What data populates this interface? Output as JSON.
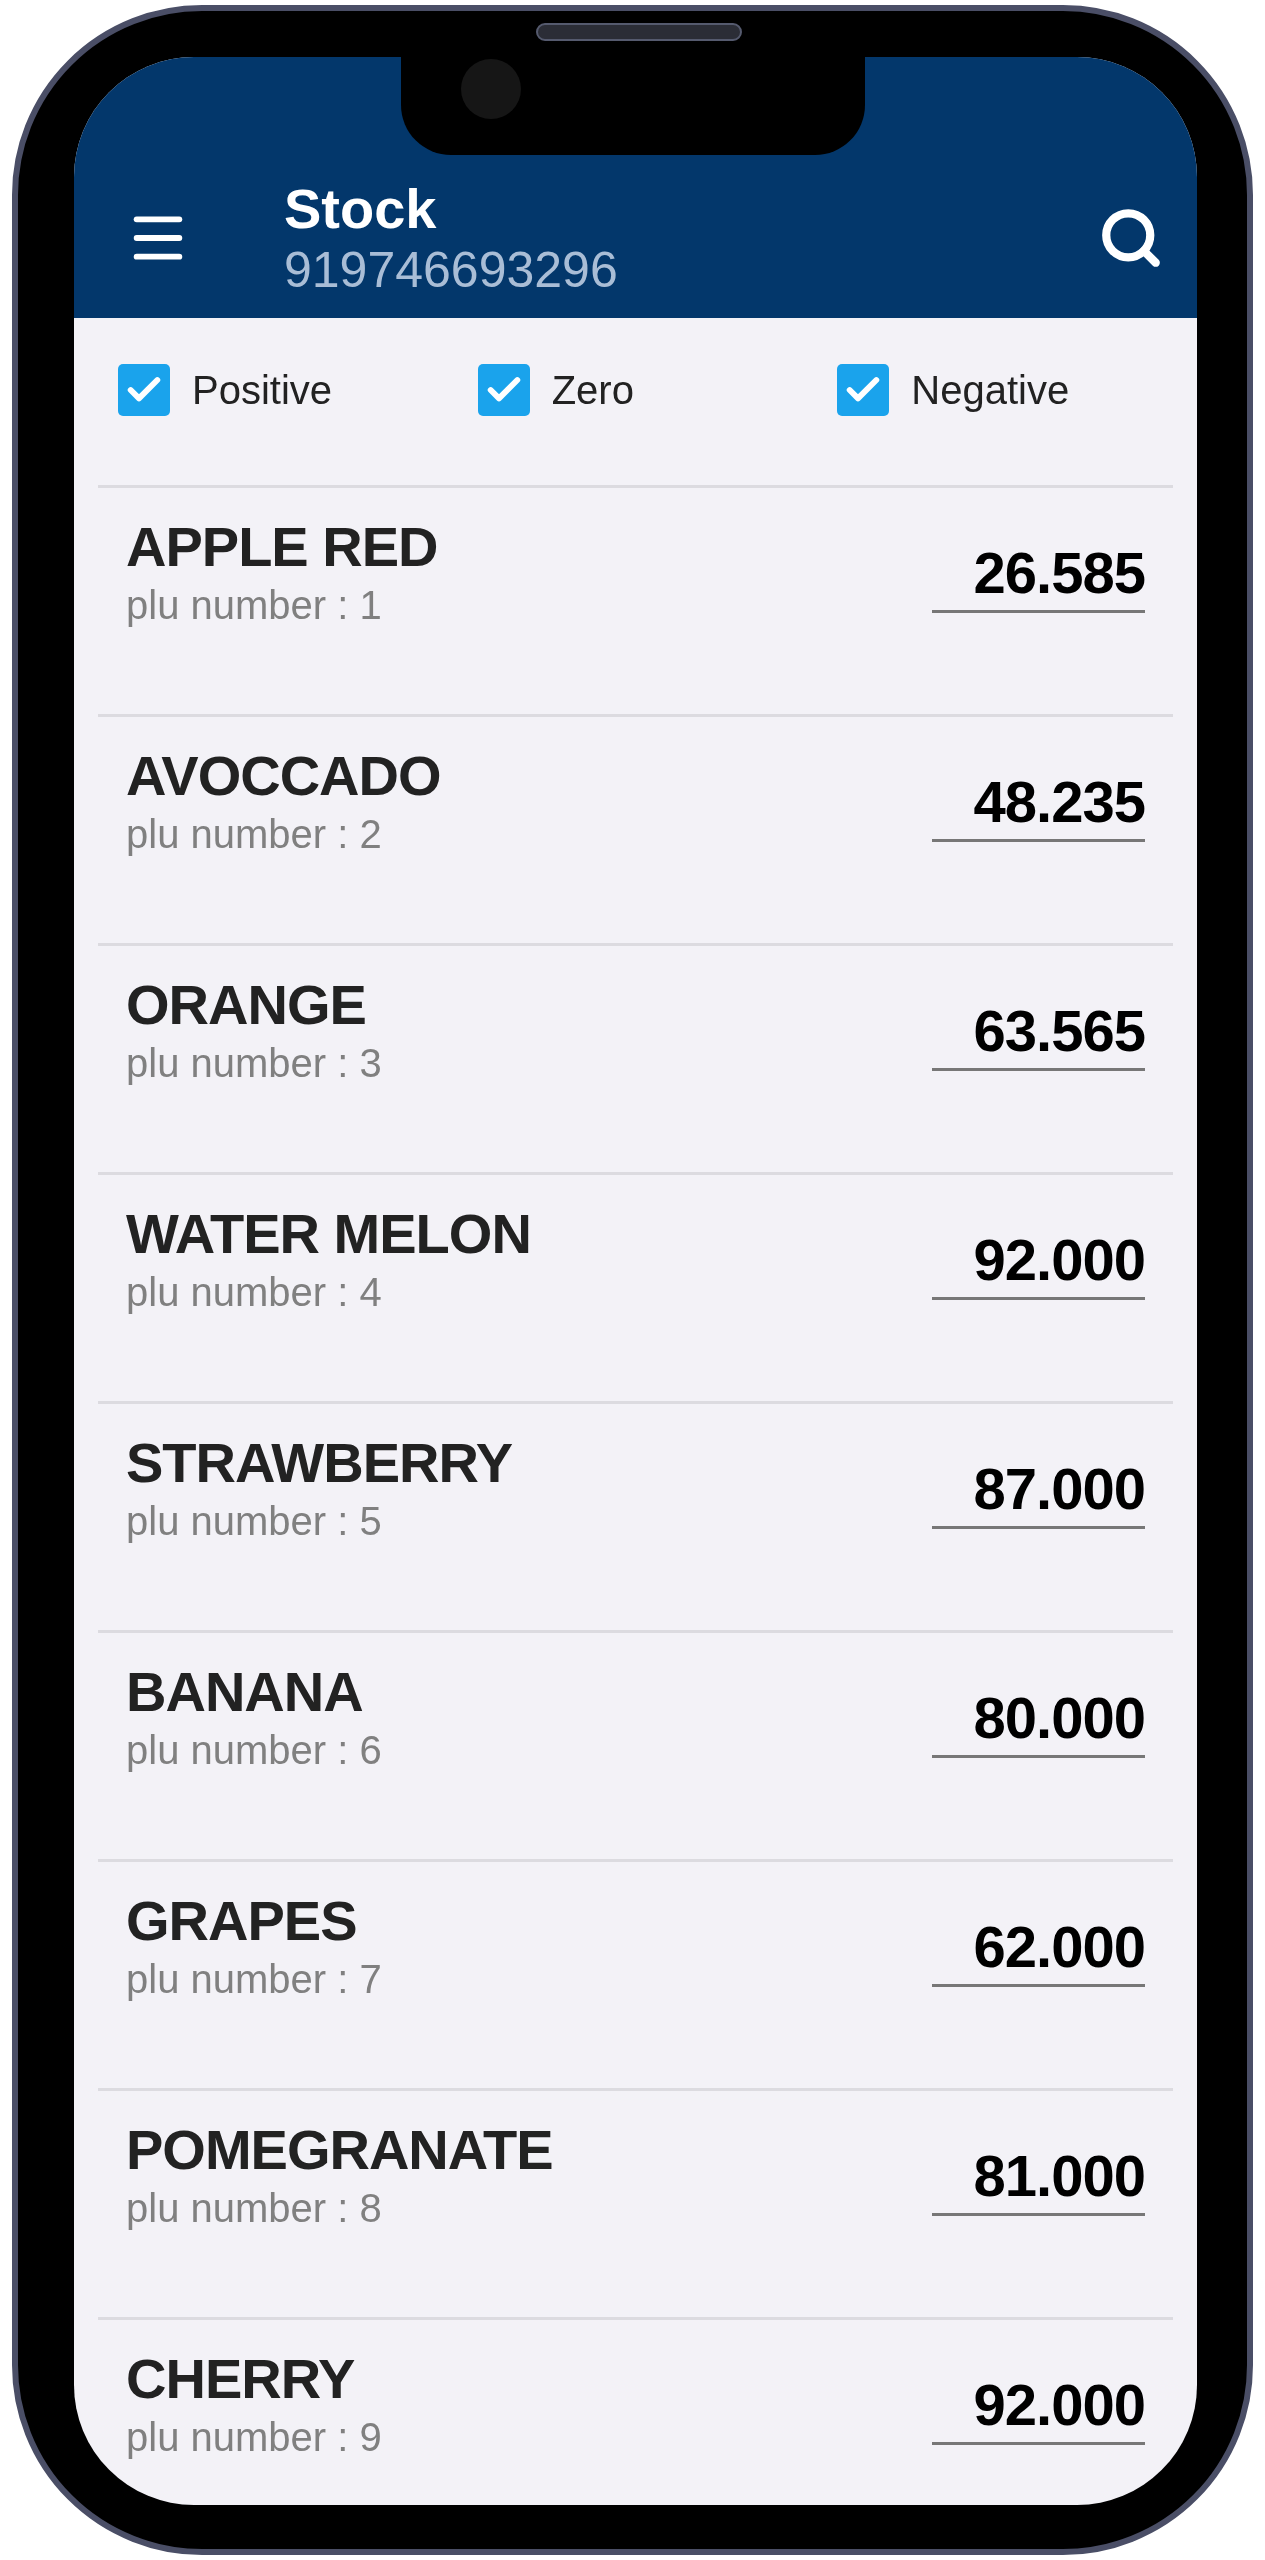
{
  "header": {
    "title": "Stock",
    "subtitle": "919746693296"
  },
  "filters": [
    {
      "label": "Positive",
      "checked": true
    },
    {
      "label": "Zero",
      "checked": true
    },
    {
      "label": "Negative",
      "checked": true
    }
  ],
  "items": [
    {
      "name": "APPLE RED",
      "plu": "plu number : 1",
      "quantity": "26.585"
    },
    {
      "name": "AVOCCADO",
      "plu": "plu number : 2",
      "quantity": "48.235"
    },
    {
      "name": "ORANGE",
      "plu": "plu number : 3",
      "quantity": "63.565"
    },
    {
      "name": "WATER MELON",
      "plu": "plu number : 4",
      "quantity": "92.000"
    },
    {
      "name": "STRAWBERRY",
      "plu": "plu number : 5",
      "quantity": "87.000"
    },
    {
      "name": "BANANA",
      "plu": "plu number : 6",
      "quantity": "80.000"
    },
    {
      "name": "GRAPES",
      "plu": "plu number : 7",
      "quantity": "62.000"
    },
    {
      "name": "POMEGRANATE",
      "plu": "plu number : 8",
      "quantity": "81.000"
    },
    {
      "name": "CHERRY",
      "plu": "plu number : 9",
      "quantity": "92.000"
    }
  ]
}
